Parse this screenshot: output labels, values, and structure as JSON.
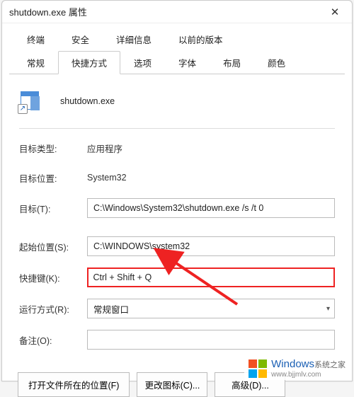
{
  "window": {
    "title": "shutdown.exe 属性"
  },
  "tabs": {
    "row1": [
      "终端",
      "安全",
      "详细信息",
      "以前的版本"
    ],
    "row2": [
      "常规",
      "快捷方式",
      "选项",
      "字体",
      "布局",
      "颜色"
    ],
    "active": "快捷方式"
  },
  "icon": {
    "arrow_glyph": "↗"
  },
  "filename": "shutdown.exe",
  "fields": {
    "target_type": {
      "label": "目标类型:",
      "value": "应用程序"
    },
    "target_loc": {
      "label": "目标位置:",
      "value": "System32"
    },
    "target": {
      "label": "目标(T):",
      "value": "C:\\Windows\\System32\\shutdown.exe /s /t 0"
    },
    "start_in": {
      "label": "起始位置(S):",
      "value": "C:\\WINDOWS\\system32"
    },
    "shortcut": {
      "label": "快捷键(K):",
      "value": "Ctrl + Shift + Q"
    },
    "run": {
      "label": "运行方式(R):",
      "value": "常规窗口"
    },
    "comment": {
      "label": "备注(O):",
      "value": ""
    }
  },
  "buttons": {
    "open_loc": "打开文件所在的位置(F)",
    "change_icon": "更改图标(C)...",
    "advanced": "高级(D)..."
  },
  "watermark": {
    "text": "Windows",
    "sub": "系统之家",
    "url": "www.bjjmlv.com"
  }
}
